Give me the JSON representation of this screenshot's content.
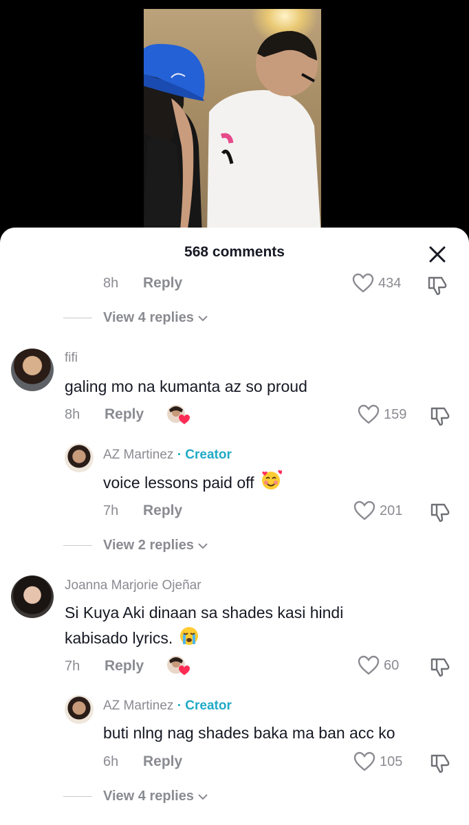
{
  "header": {
    "title": "568 comments"
  },
  "top_reply": {
    "time": "8h",
    "reply_label": "Reply",
    "likes": "434",
    "view_replies": "View 4 replies"
  },
  "comments": [
    {
      "user": "fifi",
      "text": "galing mo na kumanta az so proud",
      "time": "8h",
      "reply_label": "Reply",
      "likes": "159",
      "reply": {
        "user": "AZ Martinez",
        "badge": "· Creator",
        "text": "voice lessons paid off",
        "emoji": "smiling-face-with-hearts",
        "time": "7h",
        "reply_label": "Reply",
        "likes": "201"
      },
      "view_replies": "View 2 replies"
    },
    {
      "user": "Joanna Marjorie Ojeñar",
      "text_line1": "Si Kuya Aki dinaan sa shades kasi hindi",
      "text_line2": "kabisado lyrics.",
      "emoji": "loudly-crying-face",
      "time": "7h",
      "reply_label": "Reply",
      "likes": "60",
      "reply": {
        "user": "AZ Martinez",
        "badge": "· Creator",
        "text": "buti nlng nag shades baka ma ban acc ko",
        "time": "6h",
        "reply_label": "Reply",
        "likes": "105"
      },
      "view_replies": "View 4 replies"
    }
  ],
  "colors": {
    "creator": "#20aac6",
    "secondary_text": "#8a8b91",
    "primary_text": "#161823",
    "heart": "#fe2c55"
  }
}
